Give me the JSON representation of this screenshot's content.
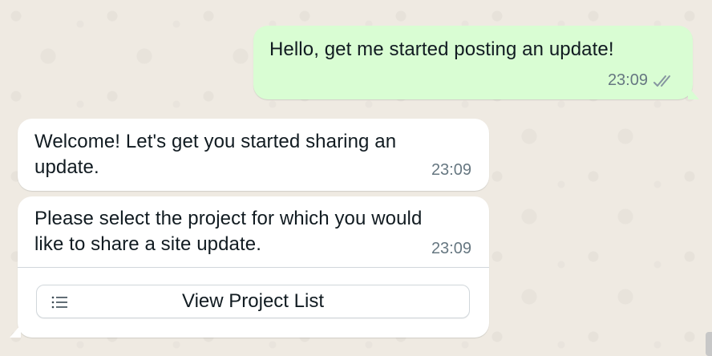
{
  "conversation": {
    "messages": [
      {
        "direction": "outgoing",
        "text": "Hello, get me started posting an update!",
        "time": "23:09",
        "status": "double-check-icon"
      },
      {
        "direction": "incoming",
        "text_line1": "Welcome! Let's get you started sharing an",
        "text_line2": "update.",
        "time": "23:09"
      },
      {
        "direction": "incoming",
        "text_line1": "Please select the project for which you would",
        "text_line2": "like to share a site update.",
        "time": "23:09",
        "action": {
          "label": "View Project List",
          "icon": "list-icon"
        }
      }
    ]
  },
  "colors": {
    "background": "#efeae2",
    "outgoing_bubble": "#d9fdd3",
    "incoming_bubble": "#ffffff",
    "timestamp": "#667781",
    "text": "#111b21"
  }
}
